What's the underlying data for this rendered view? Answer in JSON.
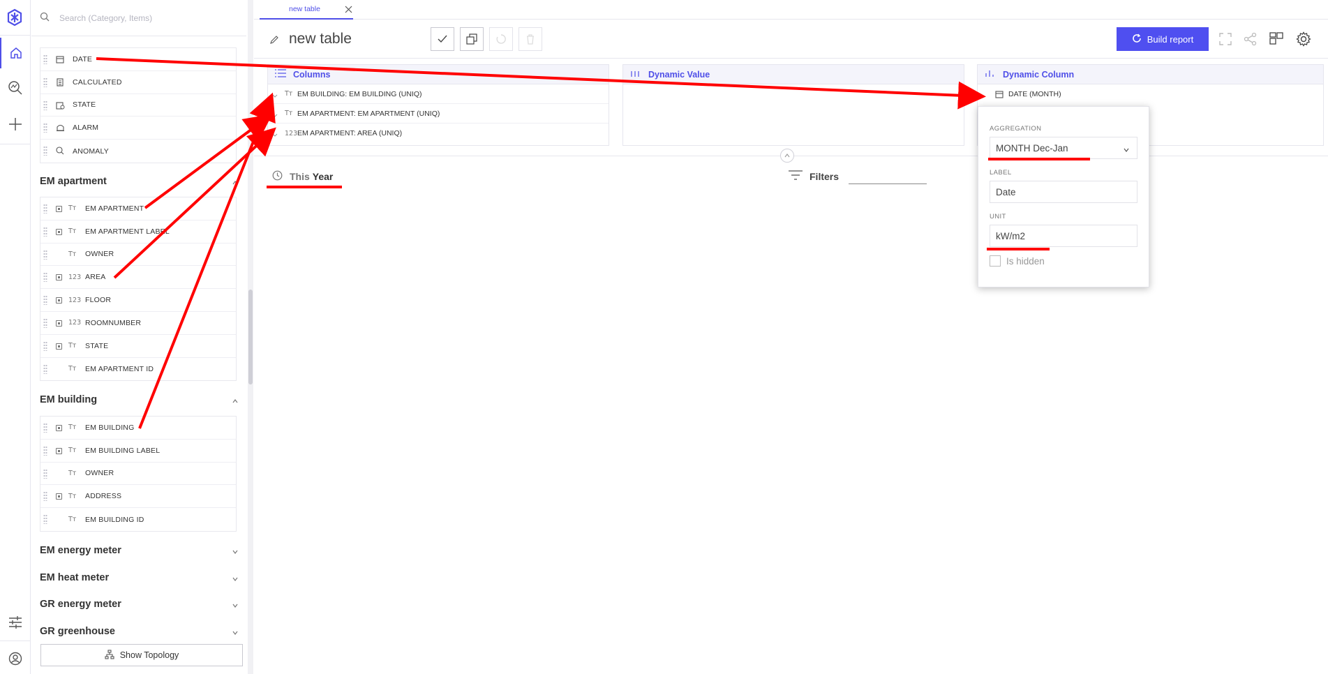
{
  "sidebar": {
    "search_placeholder": "Search (Category, Items)",
    "top_items": [
      {
        "label": "DATE",
        "icon": "calendar-icon"
      },
      {
        "label": "CALCULATED",
        "icon": "calculator-icon"
      },
      {
        "label": "STATE",
        "icon": "state-icon"
      },
      {
        "label": "ALARM",
        "icon": "alarm-icon"
      },
      {
        "label": "ANOMALY",
        "icon": "anomaly-search-icon"
      }
    ],
    "groups": [
      {
        "title": "EM apartment",
        "expanded": true,
        "items": [
          {
            "label": "EM APARTMENT",
            "type": "Tт",
            "checkbox": true
          },
          {
            "label": "EM APARTMENT LABEL",
            "type": "Tт",
            "checkbox": true
          },
          {
            "label": "OWNER",
            "type": "Tт",
            "checkbox": false
          },
          {
            "label": "AREA",
            "type": "123",
            "checkbox": true
          },
          {
            "label": "FLOOR",
            "type": "123",
            "checkbox": true
          },
          {
            "label": "ROOMNUMBER",
            "type": "123",
            "checkbox": true
          },
          {
            "label": "STATE",
            "type": "Tт",
            "checkbox": true
          },
          {
            "label": "EM APARTMENT ID",
            "type": "Tт",
            "checkbox": false
          }
        ]
      },
      {
        "title": "EM building",
        "expanded": true,
        "items": [
          {
            "label": "EM BUILDING",
            "type": "Tт",
            "checkbox": true
          },
          {
            "label": "EM BUILDING LABEL",
            "type": "Tт",
            "checkbox": true
          },
          {
            "label": "OWNER",
            "type": "Tт",
            "checkbox": false
          },
          {
            "label": "ADDRESS",
            "type": "Tт",
            "checkbox": true
          },
          {
            "label": "EM BUILDING ID",
            "type": "Tт",
            "checkbox": false
          }
        ]
      }
    ],
    "collapsed_groups": [
      "EM energy meter",
      "EM heat meter",
      "GR energy meter",
      "GR greenhouse"
    ],
    "show_topology_label": "Show Topology"
  },
  "tab": {
    "label": "new table"
  },
  "header": {
    "title": "new table",
    "build_report_label": "Build report"
  },
  "panels": {
    "columns": {
      "title": "Columns",
      "rows": [
        {
          "type": "Tт",
          "label": "EM BUILDING: EM BUILDING (UNIQ)"
        },
        {
          "type": "Tт",
          "label": "EM APARTMENT: EM APARTMENT (UNIQ)"
        },
        {
          "type": "123",
          "label": "EM APARTMENT: AREA (UNIQ)"
        }
      ]
    },
    "dynamic_value": {
      "title": "Dynamic Value"
    },
    "dynamic_column": {
      "title": "Dynamic Column",
      "rows": [
        {
          "label": "DATE (MONTH)"
        }
      ]
    }
  },
  "time_filter": {
    "this": "This",
    "period": "Year"
  },
  "filters_label": "Filters",
  "popover": {
    "aggregation_label": "AGGREGATION",
    "aggregation_value": "MONTH Dec-Jan",
    "label_label": "LABEL",
    "label_value": "Date",
    "unit_label": "UNIT",
    "unit_value": "kW/m2",
    "is_hidden_label": "Is hidden",
    "is_hidden": false
  },
  "colors": {
    "accent": "#4f4fe8",
    "annotation": "#ff0000"
  }
}
